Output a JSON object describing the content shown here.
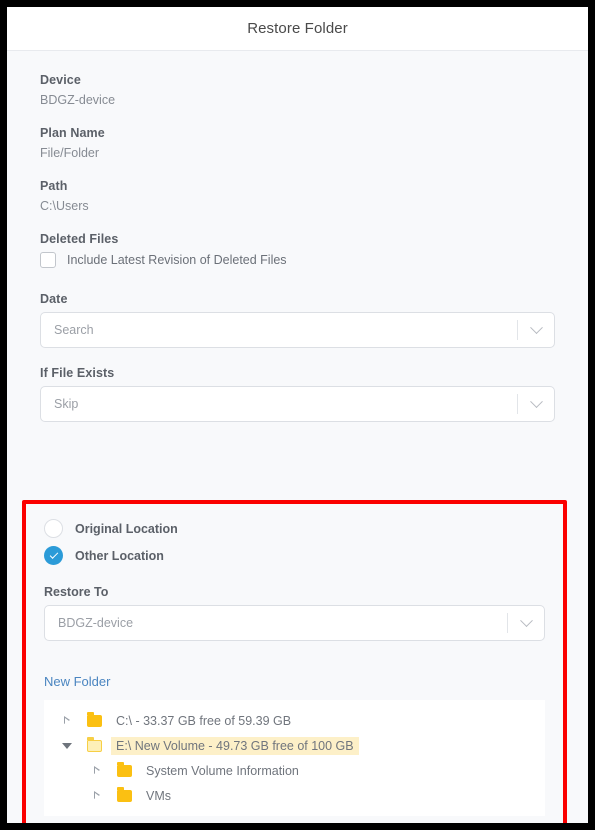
{
  "dialog": {
    "title": "Restore Folder"
  },
  "fields": {
    "device_label": "Device",
    "device_value": "BDGZ-device",
    "plan_name_label": "Plan Name",
    "plan_name_value": "File/Folder",
    "path_label": "Path",
    "path_value": "C:\\Users",
    "deleted_files_label": "Deleted Files",
    "include_deleted_label": "Include Latest Revision of Deleted Files",
    "include_deleted_checked": false,
    "date_label": "Date",
    "date_placeholder": "Search",
    "if_file_exists_label": "If File Exists",
    "if_file_exists_value": "Skip"
  },
  "location": {
    "original_label": "Original Location",
    "original_selected": false,
    "other_label": "Other Location",
    "other_selected": true,
    "restore_to_label": "Restore To",
    "restore_to_value": "BDGZ-device",
    "new_folder_link": "New Folder"
  },
  "tree": {
    "rows": [
      {
        "label": "C:\\ - 33.37 GB free of 59.39 GB",
        "expanded": false,
        "indent": false,
        "selected": false,
        "icon": "folder-closed-icon",
        "toggle": "triangle-right-icon"
      },
      {
        "label": "E:\\ New Volume - 49.73 GB free of 100 GB",
        "expanded": true,
        "indent": false,
        "selected": true,
        "icon": "folder-open-icon",
        "toggle": "triangle-down-icon"
      },
      {
        "label": "System Volume Information",
        "expanded": false,
        "indent": true,
        "selected": false,
        "icon": "folder-closed-icon",
        "toggle": "triangle-right-icon"
      },
      {
        "label": "VMs",
        "expanded": false,
        "indent": true,
        "selected": false,
        "icon": "folder-closed-icon",
        "toggle": "triangle-right-icon"
      }
    ]
  },
  "colors": {
    "accent_blue": "#2b9bd8",
    "link_blue": "#4a85c0",
    "highlight_red": "#fb0000",
    "folder_yellow": "#fbc012",
    "row_highlight": "#fdf0c8"
  }
}
